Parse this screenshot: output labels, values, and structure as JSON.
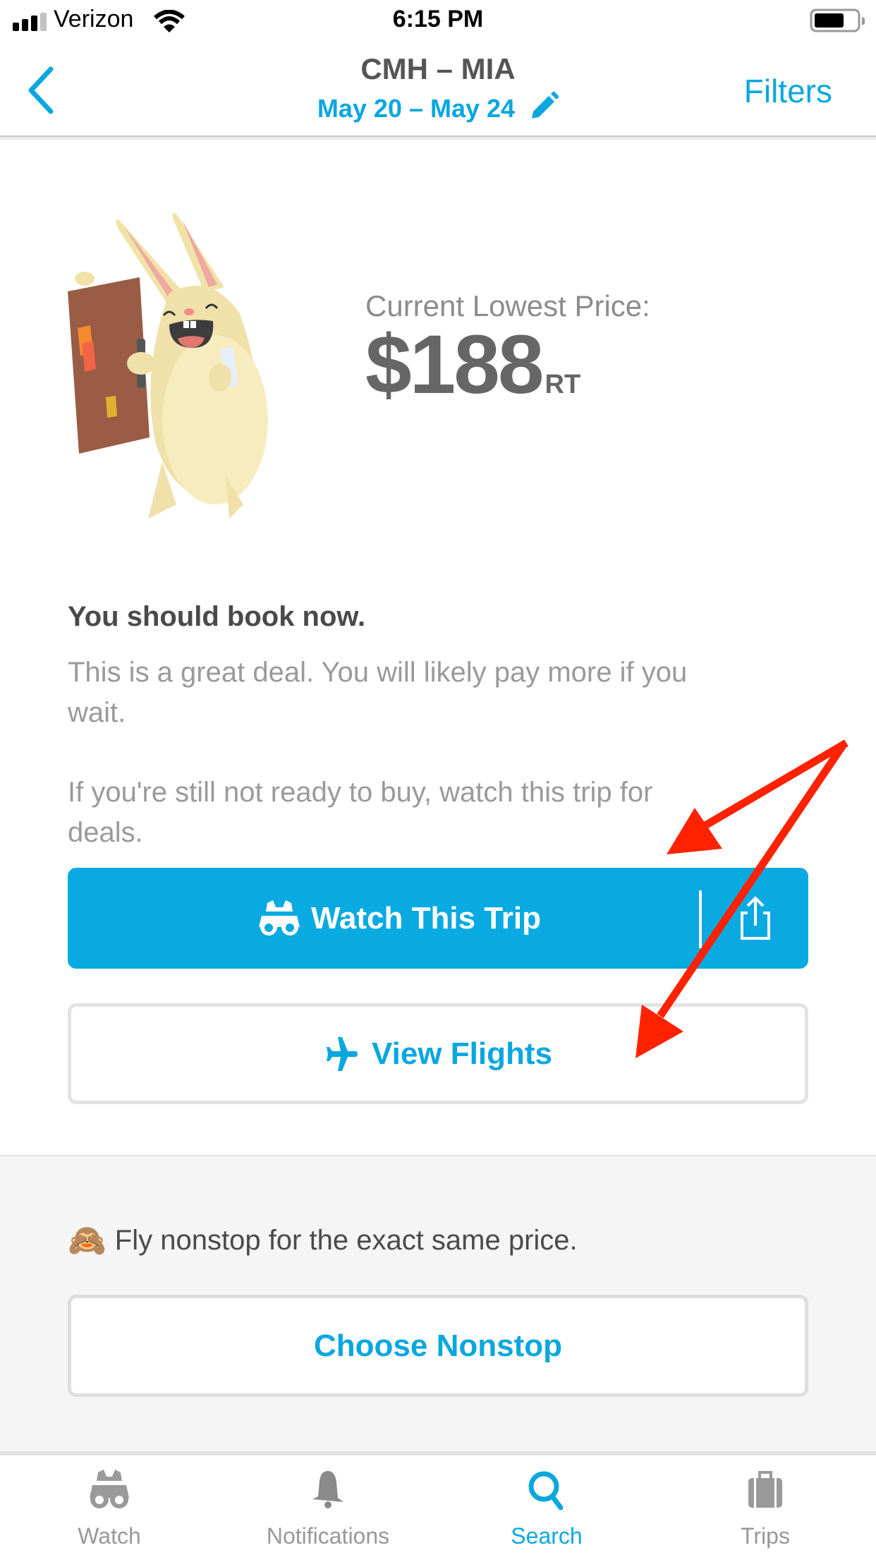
{
  "status_bar": {
    "carrier": "Verizon",
    "time": "6:15 PM",
    "signal_bars_filled": 3,
    "signal_bars_total": 4,
    "battery_level": 0.7
  },
  "header": {
    "back_icon": "chevron-left-icon",
    "route": "CMH – MIA",
    "dates": "May 20 – May 24",
    "edit_icon": "pencil-icon",
    "filters_label": "Filters"
  },
  "price": {
    "label": "Current Lowest Price:",
    "amount": "$188",
    "suffix": "RT",
    "illustration": "bunny-with-suitcase"
  },
  "advice": {
    "title": "You should book now.",
    "body_1": "This is a great deal. You will likely pay more if you wait.",
    "body_2": "If you're still not ready to buy, watch this trip for deals."
  },
  "actions": {
    "watch_label": "Watch This Trip",
    "watch_icon": "binoculars-icon",
    "share_icon": "share-icon",
    "view_flights_label": "View Flights",
    "view_flights_icon": "airplane-icon"
  },
  "nonstop": {
    "emoji": "🙈",
    "text": "Fly nonstop for the exact same price.",
    "button_label": "Choose Nonstop"
  },
  "tabs": [
    {
      "label": "Watch",
      "icon": "binoculars-icon",
      "active": false
    },
    {
      "label": "Notifications",
      "icon": "bell-icon",
      "active": false
    },
    {
      "label": "Search",
      "icon": "search-icon",
      "active": true
    },
    {
      "label": "Trips",
      "icon": "suitcase-icon",
      "active": false
    }
  ],
  "annotation": {
    "arrows": 2,
    "color": "#ff2200"
  },
  "colors": {
    "accent": "#0aa7df",
    "watch_button": "#08aae1",
    "text_dark": "#4a4a4a",
    "text_muted": "#9a9a9a"
  }
}
